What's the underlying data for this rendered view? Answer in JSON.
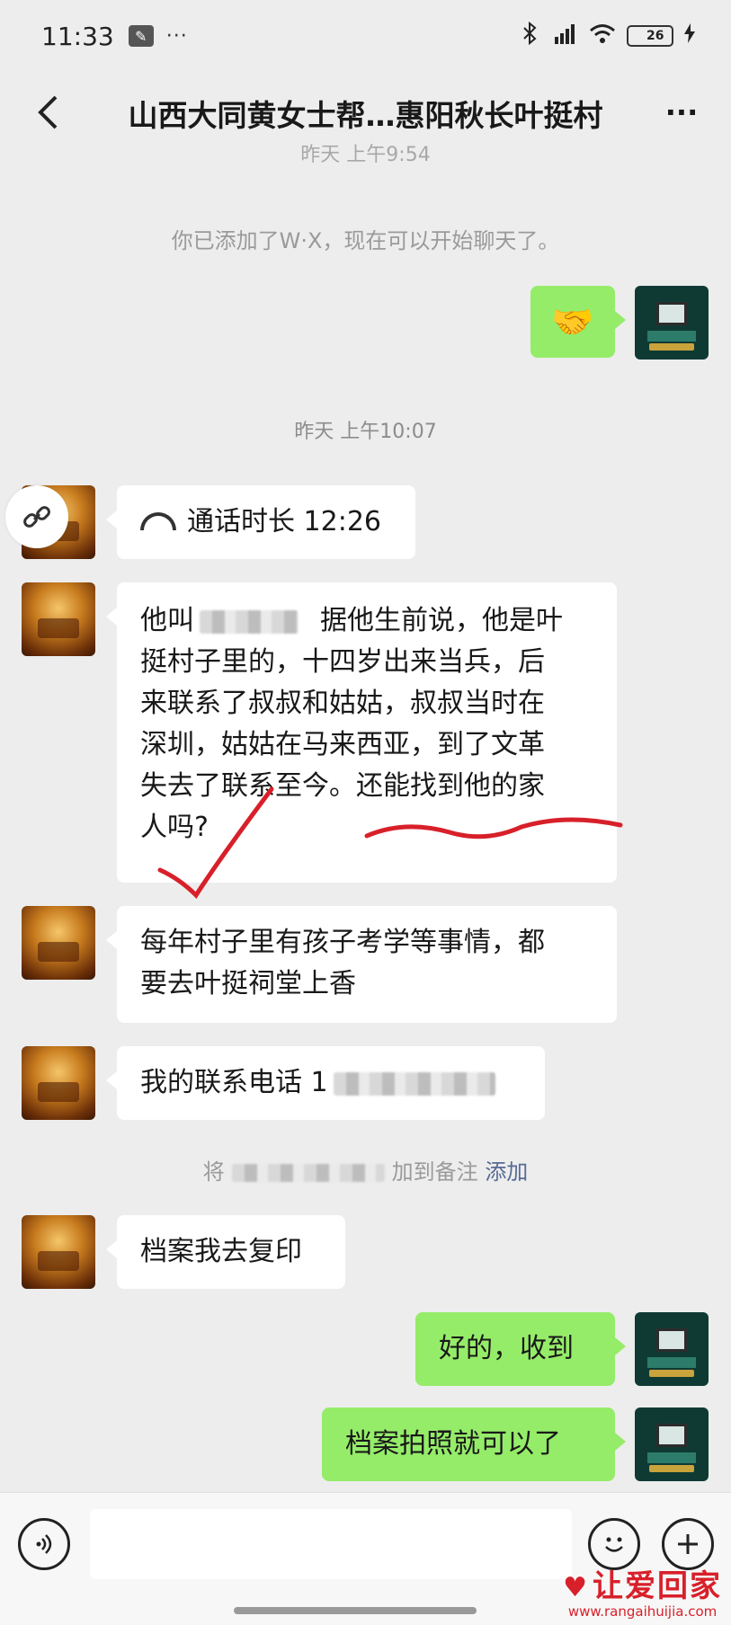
{
  "status_bar": {
    "time": "11:33",
    "battery": "26"
  },
  "header": {
    "title": "山西大同黄女士帮…惠阳秋长叶挺村"
  },
  "timestamps": {
    "first": "昨天 上午9:54",
    "second": "昨天 上午10:07"
  },
  "system_notes": {
    "added_friend": "你已添加了W·X，现在可以开始聊天了。",
    "remark_prefix": "将",
    "remark_suffix": "加到备注",
    "remark_action": "添加"
  },
  "messages": [
    {
      "side": "out",
      "type": "emoji",
      "text": "🤝"
    },
    {
      "side": "in",
      "type": "call",
      "text": "通话时长 12:26"
    },
    {
      "side": "in",
      "type": "text",
      "lines": [
        "他叫",
        "据他生前说，他是叶",
        "挺村子里的，十四岁出来当兵，后",
        "来联系了叔叔和姑姑，叔叔当时在",
        "深圳，姑姑在马来西亚，到了文革",
        "失去了联系至今。还能找到他的家",
        "人吗?"
      ]
    },
    {
      "side": "in",
      "type": "text",
      "lines": [
        "每年村子里有孩子考学等事情，都",
        "要去叶挺祠堂上香"
      ]
    },
    {
      "side": "in",
      "type": "text",
      "text": "我的联系电话 1"
    },
    {
      "side": "in",
      "type": "text",
      "text": "档案我去复印"
    },
    {
      "side": "out",
      "type": "text",
      "text": "好的，收到"
    },
    {
      "side": "out",
      "type": "text",
      "text": "档案拍照就可以了"
    }
  ],
  "input_bar": {
    "placeholder": ""
  },
  "watermark": {
    "title": "让爱回家",
    "url": "www.rangaihuijia.com"
  },
  "colors": {
    "background": "#ededed",
    "outgoing_bubble": "#95ec69",
    "incoming_bubble": "#ffffff",
    "link_blue": "#576b95",
    "annotation_red": "#d8202a"
  }
}
